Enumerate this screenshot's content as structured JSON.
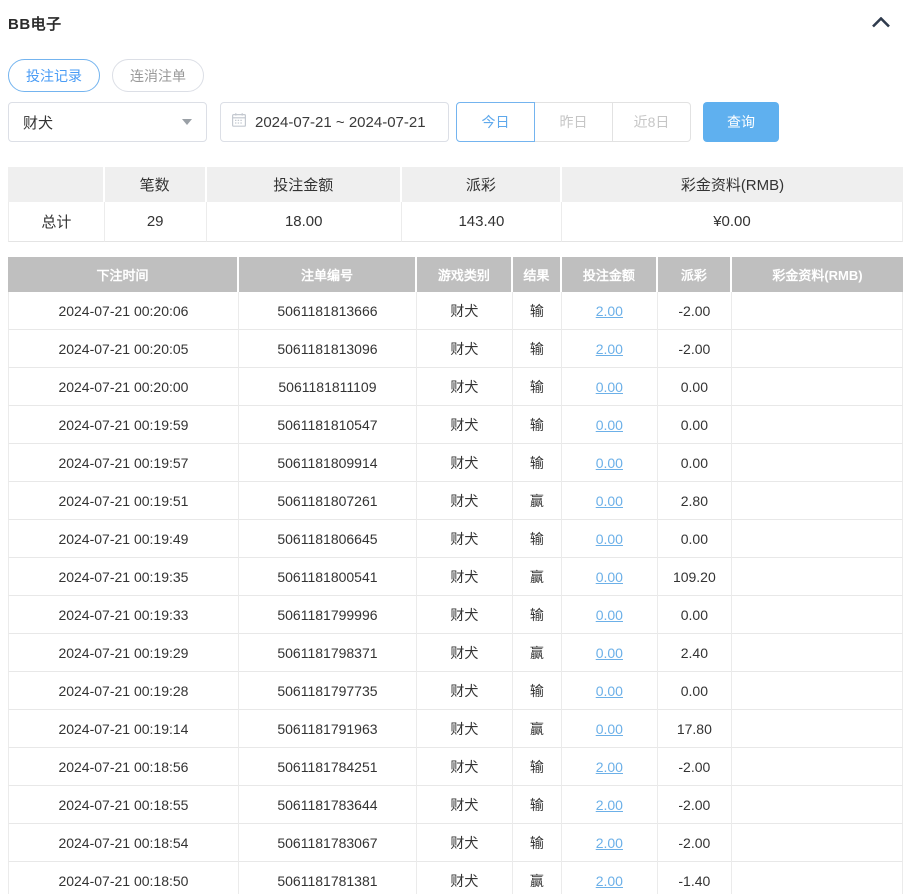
{
  "header": {
    "title": "BB电子",
    "collapse_icon": "chevron-up-icon"
  },
  "tabs": [
    {
      "label": "投注记录",
      "active": true
    },
    {
      "label": "连消注单",
      "active": false
    }
  ],
  "toolbar": {
    "game_select": {
      "value": "财犬",
      "icon": "caret-down-icon"
    },
    "date_range": {
      "value": "2024-07-21 ~ 2024-07-21",
      "icon": "calendar-icon"
    },
    "quick_buttons": [
      {
        "label": "今日",
        "active": true
      },
      {
        "label": "昨日",
        "active": false
      },
      {
        "label": "近8日",
        "active": false
      }
    ],
    "query_label": "查询"
  },
  "summary": {
    "headers": [
      "",
      "笔数",
      "投注金额",
      "派彩",
      "彩金资料(RMB)"
    ],
    "row": {
      "label": "总计",
      "count": "29",
      "bet_amount": "18.00",
      "payout": "143.40",
      "bonus": "¥0.00"
    }
  },
  "table": {
    "headers": [
      "下注时间",
      "注单编号",
      "游戏类别",
      "结果",
      "投注金额",
      "派彩",
      "彩金资料(RMB)"
    ],
    "rows": [
      {
        "time": "2024-07-21 00:20:06",
        "bet_id": "5061181813666",
        "game": "财犬",
        "result": "输",
        "bet": "2.00",
        "payout": "-2.00",
        "bonus": ""
      },
      {
        "time": "2024-07-21 00:20:05",
        "bet_id": "5061181813096",
        "game": "财犬",
        "result": "输",
        "bet": "2.00",
        "payout": "-2.00",
        "bonus": ""
      },
      {
        "time": "2024-07-21 00:20:00",
        "bet_id": "5061181811109",
        "game": "财犬",
        "result": "输",
        "bet": "0.00",
        "payout": "0.00",
        "bonus": ""
      },
      {
        "time": "2024-07-21 00:19:59",
        "bet_id": "5061181810547",
        "game": "财犬",
        "result": "输",
        "bet": "0.00",
        "payout": "0.00",
        "bonus": ""
      },
      {
        "time": "2024-07-21 00:19:57",
        "bet_id": "5061181809914",
        "game": "财犬",
        "result": "输",
        "bet": "0.00",
        "payout": "0.00",
        "bonus": ""
      },
      {
        "time": "2024-07-21 00:19:51",
        "bet_id": "5061181807261",
        "game": "财犬",
        "result": "赢",
        "bet": "0.00",
        "payout": "2.80",
        "bonus": ""
      },
      {
        "time": "2024-07-21 00:19:49",
        "bet_id": "5061181806645",
        "game": "财犬",
        "result": "输",
        "bet": "0.00",
        "payout": "0.00",
        "bonus": ""
      },
      {
        "time": "2024-07-21 00:19:35",
        "bet_id": "5061181800541",
        "game": "财犬",
        "result": "赢",
        "bet": "0.00",
        "payout": "109.20",
        "bonus": ""
      },
      {
        "time": "2024-07-21 00:19:33",
        "bet_id": "5061181799996",
        "game": "财犬",
        "result": "输",
        "bet": "0.00",
        "payout": "0.00",
        "bonus": ""
      },
      {
        "time": "2024-07-21 00:19:29",
        "bet_id": "5061181798371",
        "game": "财犬",
        "result": "赢",
        "bet": "0.00",
        "payout": "2.40",
        "bonus": ""
      },
      {
        "time": "2024-07-21 00:19:28",
        "bet_id": "5061181797735",
        "game": "财犬",
        "result": "输",
        "bet": "0.00",
        "payout": "0.00",
        "bonus": ""
      },
      {
        "time": "2024-07-21 00:19:14",
        "bet_id": "5061181791963",
        "game": "财犬",
        "result": "赢",
        "bet": "0.00",
        "payout": "17.80",
        "bonus": ""
      },
      {
        "time": "2024-07-21 00:18:56",
        "bet_id": "5061181784251",
        "game": "财犬",
        "result": "输",
        "bet": "2.00",
        "payout": "-2.00",
        "bonus": ""
      },
      {
        "time": "2024-07-21 00:18:55",
        "bet_id": "5061181783644",
        "game": "财犬",
        "result": "输",
        "bet": "2.00",
        "payout": "-2.00",
        "bonus": ""
      },
      {
        "time": "2024-07-21 00:18:54",
        "bet_id": "5061181783067",
        "game": "财犬",
        "result": "输",
        "bet": "2.00",
        "payout": "-2.00",
        "bonus": ""
      },
      {
        "time": "2024-07-21 00:18:50",
        "bet_id": "5061181781381",
        "game": "财犬",
        "result": "赢",
        "bet": "2.00",
        "payout": "-1.40",
        "bonus": ""
      }
    ]
  },
  "colors": {
    "accent_blue": "#5fb0ef",
    "link_blue": "#6cb0e8",
    "negative_red": "#dd5f5f",
    "table_header_gray": "#bfbfbf",
    "summary_header_gray": "#efefef"
  }
}
